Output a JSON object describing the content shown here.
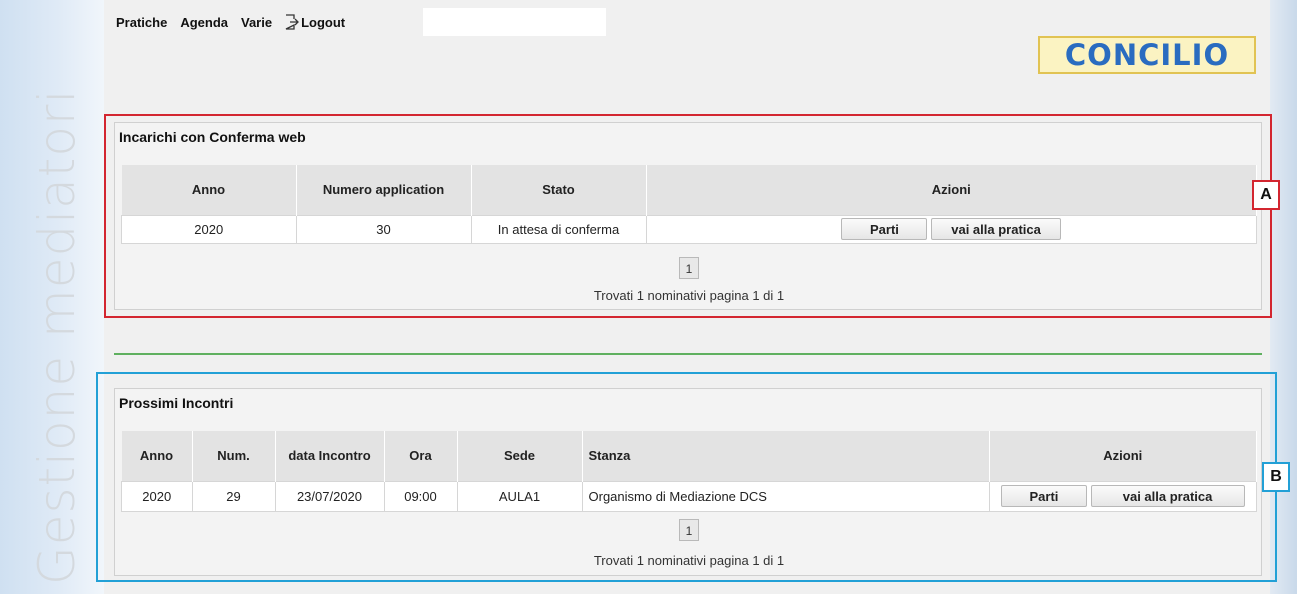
{
  "sidebar": {
    "title": "Gestione mediatori"
  },
  "menu": {
    "items": [
      "Pratiche",
      "Agenda",
      "Varie"
    ],
    "logout": "Logout"
  },
  "logo": {
    "text": "CONCILIO"
  },
  "section_a": {
    "title": "Incarichi con Conferma web",
    "headers": [
      "Anno",
      "Numero application",
      "Stato",
      "Azioni"
    ],
    "row": {
      "anno": "2020",
      "numero": "30",
      "stato": "In attesa di conferma"
    },
    "btn_parti": "Parti",
    "btn_vai": "vai alla pratica",
    "page": "1",
    "found": "Trovati 1 nominativi pagina 1 di 1",
    "label": "A"
  },
  "section_b": {
    "title": "Prossimi Incontri",
    "headers": [
      "Anno",
      "Num.",
      "data Incontro",
      "Ora",
      "Sede",
      "Stanza",
      "Azioni"
    ],
    "row": {
      "anno": "2020",
      "num": "29",
      "data": "23/07/2020",
      "ora": "09:00",
      "sede": "AULA1",
      "stanza": "Organismo di Mediazione DCS"
    },
    "btn_parti": "Parti",
    "btn_vai": "vai alla pratica",
    "page": "1",
    "found": "Trovati 1 nominativi pagina 1 di 1",
    "label": "B"
  },
  "colors": {
    "frame_a": "#d32630",
    "frame_b": "#22a0d6",
    "separator": "#5fb05f",
    "logo_text": "#2a6cc0"
  }
}
